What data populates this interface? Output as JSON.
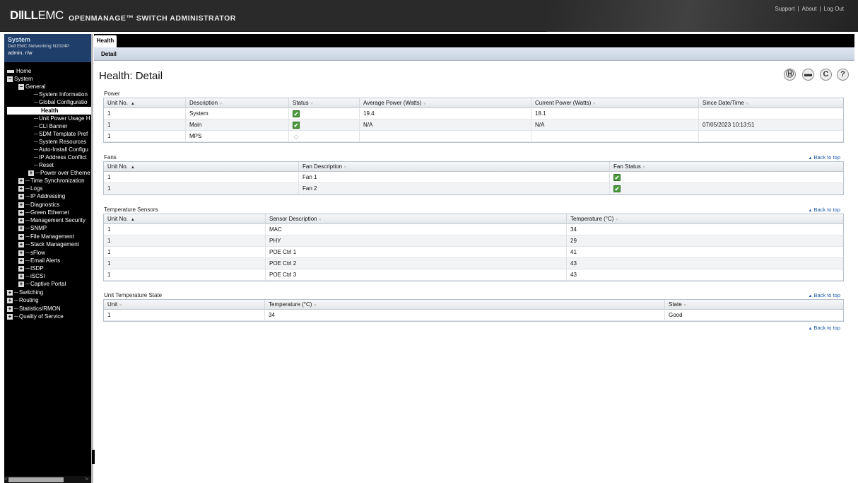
{
  "header": {
    "brand_bold": "DǁLL",
    "brand_light": "EMC",
    "product": "OPENMANAGE™ SWITCH ADMINISTRATOR",
    "links": [
      "Support",
      "About",
      "Log Out"
    ],
    "link_sep": "|"
  },
  "sidebar": {
    "system_title": "System",
    "model": "Dell EMC Networking N2024P",
    "user": "admin, r/w",
    "tree": {
      "home": "Home",
      "system": "System",
      "general": "General",
      "system_information": "System Information",
      "global_configuration": "Global Configuratio",
      "health": "Health",
      "unit_power_usage": "Unit Power Usage H",
      "cli_banner": "CLI Banner",
      "sdm_template": "SDM Template Pref",
      "system_resources": "System Resources",
      "auto_install": "Auto-Install Configu",
      "ip_address_conflict": "IP Address Conflict",
      "reset": "Reset",
      "power_over_ethernet": "Power over Etherne",
      "time_sync": "Time Synchronization",
      "logs": "Logs",
      "ip_addressing": "IP Addressing",
      "diagnostics": "Diagnostics",
      "green_ethernet": "Green Ethernet",
      "management_security": "Management Security",
      "snmp": "SNMP",
      "file_management": "File Management",
      "stack_management": "Stack Management",
      "sflow": "sFlow",
      "email_alerts": "Email Alerts",
      "isdp": "ISDP",
      "iscsi": "iSCSI",
      "captive_portal": "Captive Portal",
      "switching": "Switching",
      "routing": "Routing",
      "statistics_rmon": "Statistics/RMON",
      "qos": "Quality of Service"
    },
    "scroll_left": "<",
    "scroll_right": ">"
  },
  "tabs": {
    "main": "Health",
    "sub": "Detail"
  },
  "page": {
    "title": "Health: Detail",
    "actions": {
      "save_icon": "Ⓗ",
      "print_icon": "▬",
      "refresh_icon": "C",
      "help_icon": "?"
    },
    "back_to_top": "Back to top",
    "back_to_top_icon": "▲"
  },
  "power": {
    "title": "Power",
    "columns": [
      "Unit No.",
      "Description",
      "Status",
      "Average Power (Watts)",
      "Current Power (Watts)",
      "Since Date/Time"
    ],
    "rows": [
      {
        "unit": "1",
        "desc": "System",
        "status": "ok",
        "avg": "19.4",
        "cur": "18.1",
        "since": ""
      },
      {
        "unit": "1",
        "desc": "Main",
        "status": "ok",
        "avg": "N/A",
        "cur": "N/A",
        "since": "07/05/2023 10:13:51"
      },
      {
        "unit": "1",
        "desc": "MPS",
        "status": "na",
        "avg": "",
        "cur": "",
        "since": ""
      }
    ]
  },
  "fans": {
    "title": "Fans",
    "columns": [
      "Unit No.",
      "Fan Description",
      "Fan Status"
    ],
    "rows": [
      {
        "unit": "1",
        "desc": "Fan 1",
        "status": "ok"
      },
      {
        "unit": "1",
        "desc": "Fan 2",
        "status": "ok"
      }
    ]
  },
  "temp_sensors": {
    "title": "Temperature Sensors",
    "columns": [
      "Unit No.",
      "Sensor Description",
      "Temperature (°C)"
    ],
    "rows": [
      {
        "unit": "1",
        "desc": "MAC",
        "temp": "34"
      },
      {
        "unit": "1",
        "desc": "PHY",
        "temp": "29"
      },
      {
        "unit": "1",
        "desc": "POE Ctrl 1",
        "temp": "41"
      },
      {
        "unit": "1",
        "desc": "POE Ctrl 2",
        "temp": "43"
      },
      {
        "unit": "1",
        "desc": "POE Ctrl 3",
        "temp": "43"
      }
    ]
  },
  "unit_temp": {
    "title": "Unit Temperature State",
    "columns": [
      "Unit",
      "Temperature (°C)",
      "State"
    ],
    "rows": [
      {
        "unit": "1",
        "temp": "34",
        "state": "Good"
      }
    ]
  },
  "icons": {
    "ok": "✔",
    "na": "◇",
    "sort_asc": "▲",
    "sort_none": "▿",
    "expand": "+",
    "collapse": "−"
  },
  "colors": {
    "header_bg": "#2a2a2a",
    "system_box": "#1f3e6a",
    "link": "#1d5aa8",
    "ok_green": "#4a9a3c"
  }
}
